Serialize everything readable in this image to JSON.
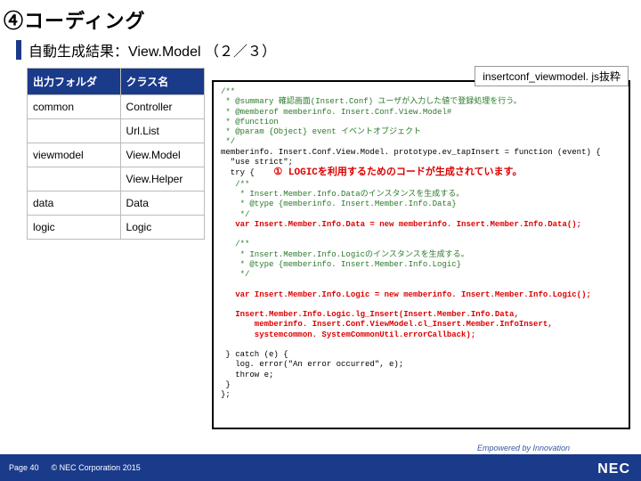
{
  "header": {
    "title": "④コーディング",
    "subtitle": "自動生成結果：View.Model （２／３）"
  },
  "table": {
    "col1": "出力フォルダ",
    "col2": "クラス名",
    "rows": [
      {
        "c1": "common",
        "c2": "Controller"
      },
      {
        "c1": "",
        "c2": "Url.List"
      },
      {
        "c1": "viewmodel",
        "c2": "View.Model"
      },
      {
        "c1": "",
        "c2": "View.Helper"
      },
      {
        "c1": "data",
        "c2": "Data"
      },
      {
        "c1": "logic",
        "c2": "Logic"
      }
    ]
  },
  "file_badge": "insertconf_viewmodel. js抜粋",
  "code": {
    "l1": "/**",
    "l2": " * @summary 確認画面(Insert.Conf) ユーザが入力した値で登録処理を行う。",
    "l3": " * @memberof memberinfo. Insert.Conf.View.Model#",
    "l4": " * @function",
    "l5": " * @param {Object} event イベントオブジェクト",
    "l6": " */",
    "l7": "memberinfo. Insert.Conf.View.Model. prototype.ev_tapInsert = function (event) {",
    "l8": "  \"use strict\";",
    "l9": "  try {",
    "l10": "   /**",
    "l11": "    * Insert.Member.Info.Dataのインスタンスを生成する。",
    "l12": "    * @type {memberinfo. Insert.Member.Info.Data}",
    "l13": "    */",
    "l14": "   var Insert.Member.Info.Data = new memberinfo. Insert.Member.Info.Data();",
    "l15": "",
    "l16": "   /**",
    "l17": "    * Insert.Member.Info.Logicのインスタンスを生成する。",
    "l18": "    * @type {memberinfo. Insert.Member.Info.Logic}",
    "l19": "    */",
    "l20": "",
    "l21": "   var Insert.Member.Info.Logic = new memberinfo. Insert.Member.Info.Logic();",
    "l22": "",
    "l23": "   Insert.Member.Info.Logic.lg_Insert(Insert.Member.Info.Data,",
    "l24": "       memberinfo. Insert.Conf.ViewModel.cl_Insert.Member.InfoInsert,",
    "l25": "       systemcommon. SystemCommonUtil.errorCallback);",
    "l26": "",
    "l27": " } catch (e) {",
    "l28": "   log. error(\"An error occurred\", e);",
    "l29": "   throw e;",
    "l30": " }",
    "l31": "};"
  },
  "annotation": "① LOGICを利用するためのコードが生成されています。",
  "footer": {
    "page": "Page 40",
    "copyright": "© NEC Corporation 2015",
    "tagline": "Empowered by Innovation",
    "logo": "NEC"
  }
}
